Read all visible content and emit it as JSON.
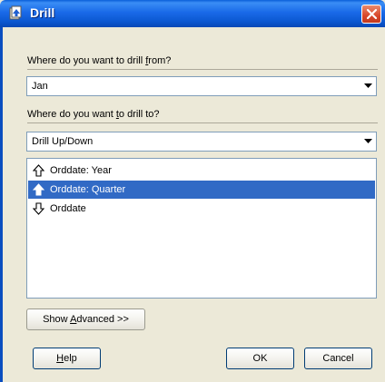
{
  "window": {
    "title": "Drill",
    "icon": "drill-window-icon"
  },
  "from": {
    "label_pre": "Where do you want to drill ",
    "label_key": "f",
    "label_post": "rom?",
    "value": "Jan"
  },
  "to": {
    "label_pre": "Where do you want ",
    "label_key": "t",
    "label_post": "o drill to?",
    "value": "Drill Up/Down"
  },
  "levels": [
    {
      "label": "Orddate: Year",
      "icon": "up-arrow-outline-icon",
      "selected": false
    },
    {
      "label": "Orddate: Quarter",
      "icon": "up-arrow-solid-icon",
      "selected": true
    },
    {
      "label": "Orddate",
      "icon": "down-arrow-outline-icon",
      "selected": false
    }
  ],
  "buttons": {
    "advanced_pre": "Show ",
    "advanced_key": "A",
    "advanced_post": "dvanced >>",
    "help_key": "H",
    "help_post": "elp",
    "ok": "OK",
    "cancel": "Cancel"
  },
  "colors": {
    "titlebar": "#0b57d0",
    "selection": "#316ac5",
    "close": "#d8472a"
  }
}
